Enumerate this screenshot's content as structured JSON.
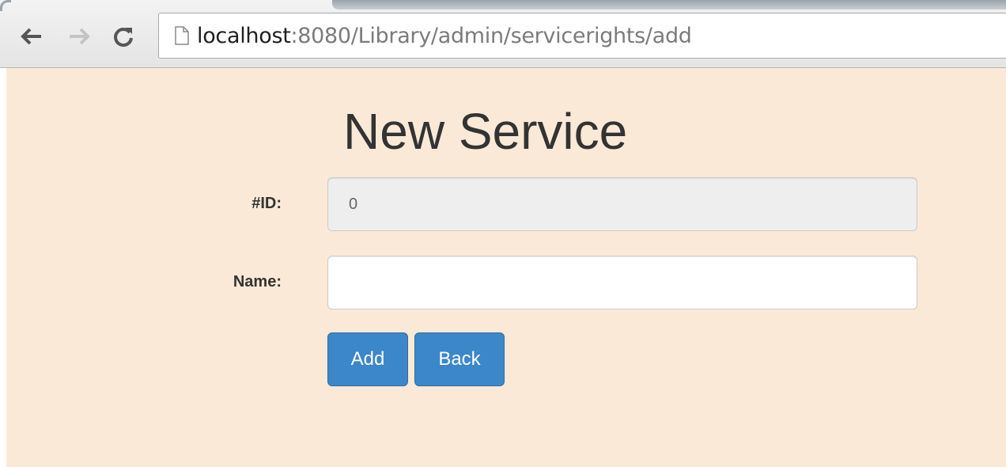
{
  "browser": {
    "url_host": "localhost",
    "url_rest": ":8080/Library/admin/servicerights/add"
  },
  "page": {
    "title": "New Service",
    "background_color": "#fae9d6"
  },
  "form": {
    "id_label": "#ID:",
    "id_value": "0",
    "name_label": "Name:",
    "name_value": "",
    "add_label": "Add",
    "back_label": "Back"
  },
  "colors": {
    "primary_button": "#3c87c9",
    "disabled_input": "#eeeeee"
  },
  "icons": {
    "back": "arrow-left-icon",
    "forward": "arrow-right-icon",
    "reload": "reload-icon",
    "page": "page-icon"
  }
}
